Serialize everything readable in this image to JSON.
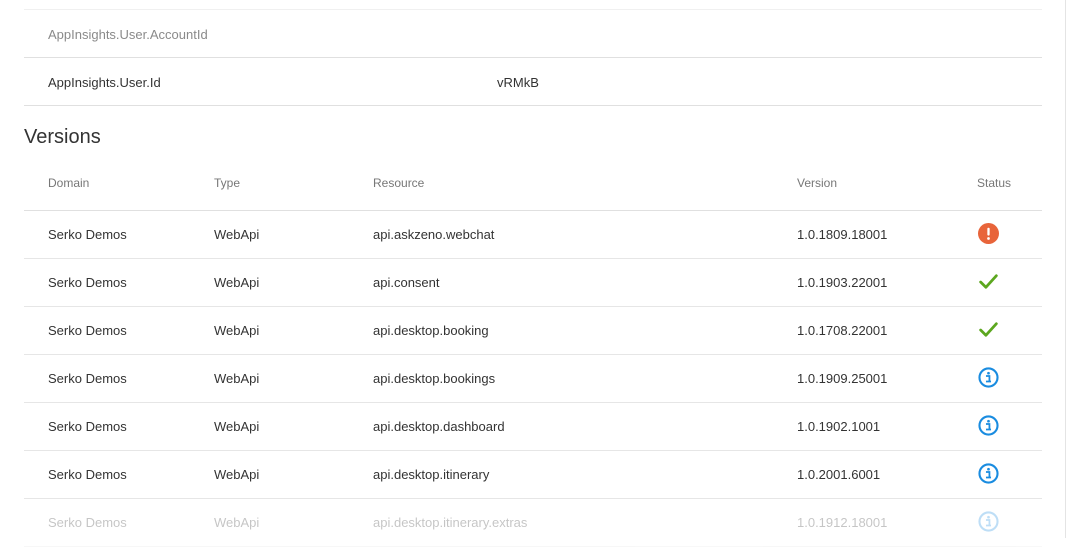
{
  "properties": [
    {
      "key": "AppInsights.User.AccountId",
      "value": "",
      "muted": true
    },
    {
      "key": "AppInsights.User.Id",
      "value": "vRMkB",
      "muted": false
    }
  ],
  "versions": {
    "title": "Versions",
    "columns": {
      "domain": "Domain",
      "type": "Type",
      "resource": "Resource",
      "version": "Version",
      "status": "Status"
    },
    "rows": [
      {
        "domain": "Serko Demos",
        "type": "WebApi",
        "resource": "api.askzeno.webchat",
        "version": "1.0.1809.18001",
        "status": "error-icon"
      },
      {
        "domain": "Serko Demos",
        "type": "WebApi",
        "resource": "api.consent",
        "version": "1.0.1903.22001",
        "status": "checkmark-icon"
      },
      {
        "domain": "Serko Demos",
        "type": "WebApi",
        "resource": "api.desktop.booking",
        "version": "1.0.1708.22001",
        "status": "checkmark-icon"
      },
      {
        "domain": "Serko Demos",
        "type": "WebApi",
        "resource": "api.desktop.bookings",
        "version": "1.0.1909.25001",
        "status": "info-icon"
      },
      {
        "domain": "Serko Demos",
        "type": "WebApi",
        "resource": "api.desktop.dashboard",
        "version": "1.0.1902.1001",
        "status": "info-icon"
      },
      {
        "domain": "Serko Demos",
        "type": "WebApi",
        "resource": "api.desktop.itinerary",
        "version": "1.0.2001.6001",
        "status": "info-icon"
      },
      {
        "domain": "Serko Demos",
        "type": "WebApi",
        "resource": "api.desktop.itinerary.extras",
        "version": "1.0.1912.18001",
        "status": "info-icon"
      }
    ]
  },
  "colors": {
    "error": "#e8643a",
    "success": "#5ca71f",
    "info": "#1a8ce0"
  }
}
